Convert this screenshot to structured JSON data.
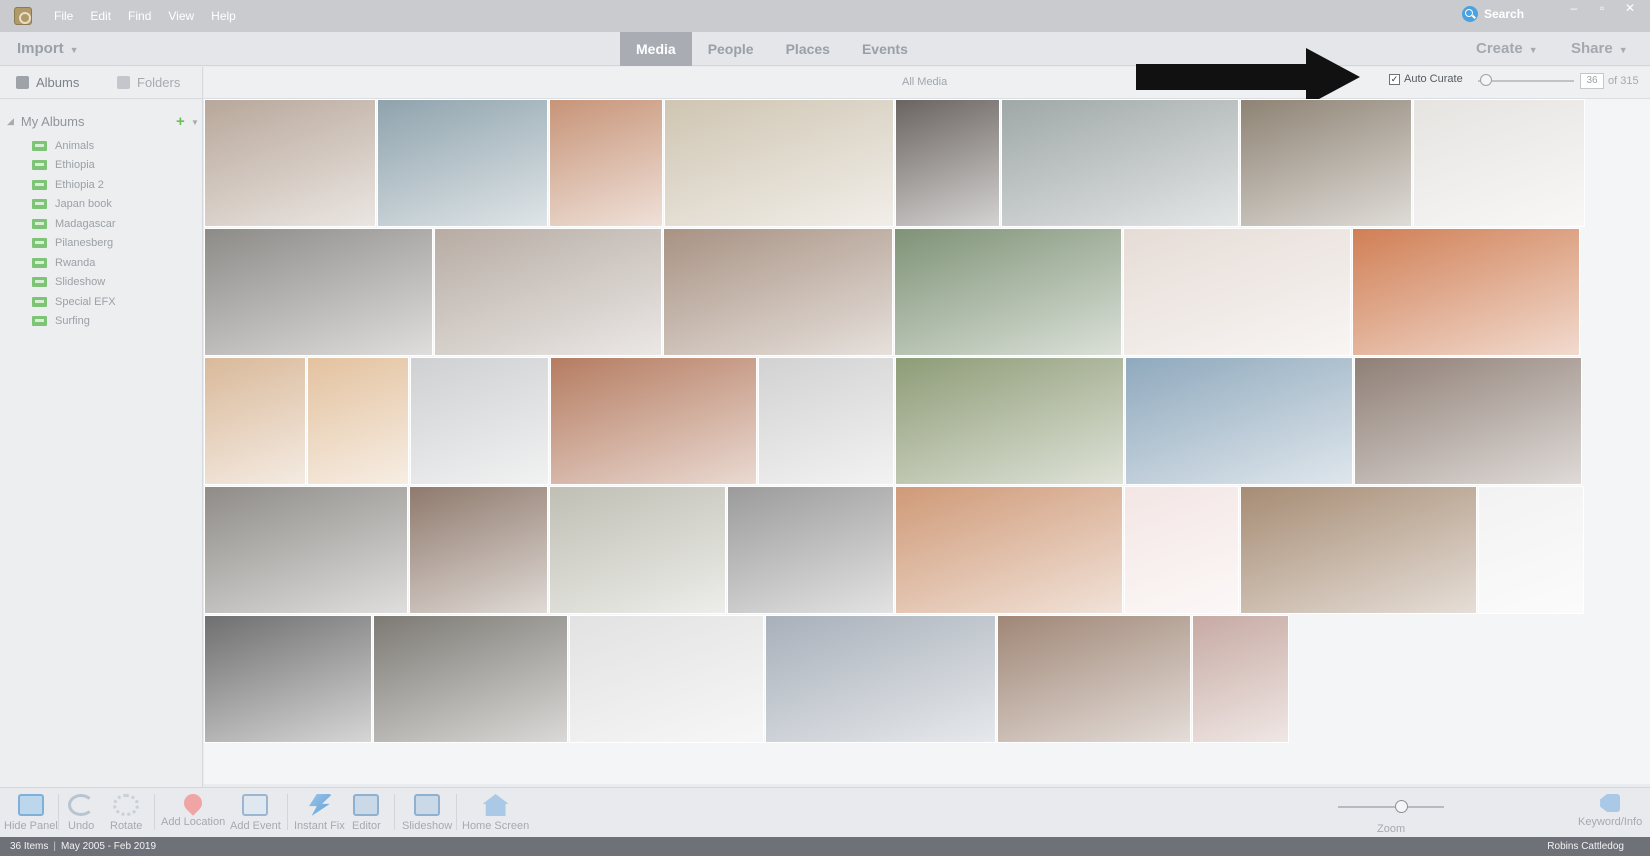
{
  "menu": [
    "File",
    "Edit",
    "Find",
    "View",
    "Help"
  ],
  "search_label": "Search",
  "window_controls": [
    "–",
    "▫",
    "✕"
  ],
  "toolbar": {
    "import_label": "Import",
    "tabs": [
      "Media",
      "People",
      "Places",
      "Events"
    ],
    "active_tab": "Media",
    "create_label": "Create",
    "share_label": "Share"
  },
  "sidebar": {
    "tabs": [
      "Albums",
      "Folders"
    ],
    "section_title": "My Albums",
    "albums": [
      "Animals",
      "Ethiopia",
      "Ethiopia 2",
      "Japan book",
      "Madagascar",
      "Pilanesberg",
      "Rwanda",
      "Slideshow",
      "Special EFX",
      "Surfing"
    ]
  },
  "content": {
    "title": "All Media",
    "auto_curate_label": "Auto Curate",
    "auto_curate_checked": true,
    "curate_count": "36",
    "curate_total": "of 315"
  },
  "bottom_tools": [
    "Hide Panel",
    "Undo",
    "Rotate",
    "Add Location",
    "Add Event",
    "Instant Fix",
    "Editor",
    "Slideshow",
    "Home Screen"
  ],
  "zoom_label": "Zoom",
  "keyword_label": "Keyword/Info",
  "status": {
    "items": "36 Items",
    "date_range": "May 2005 - Feb 2019",
    "user": "Robins Cattledog"
  },
  "thumbnail_colors": [
    "#b8a79a",
    "#8fa3ad",
    "#c79478",
    "#cfc5b2",
    "#6a6461",
    "#9fa8a7",
    "#8e8374",
    "#e6e4e1",
    "#8d8b88",
    "#b7aca4",
    "#a89283",
    "#7f9377",
    "#e6dcd6",
    "#d07f55",
    "#d9b99a",
    "#e3c29f",
    "#cfd0d2",
    "#b57c61",
    "#d2d2d2",
    "#8e9c77",
    "#8fa9bd",
    "#8f7f76",
    "#8f8c88",
    "#8f7a6d",
    "#bfbfb4",
    "#9b9b9b",
    "#cf9a78",
    "#f3e6e4",
    "#a68c74",
    "#f2f2f2",
    "#6f6f6f",
    "#7d7a74",
    "#e2e2e2",
    "#a8b0ba",
    "#a08777",
    "#c7aaa3"
  ]
}
